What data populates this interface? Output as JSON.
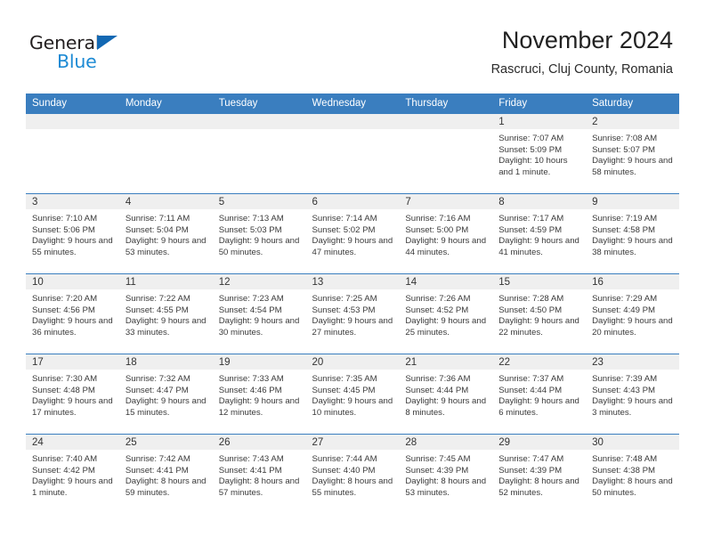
{
  "brand": {
    "word1": "General",
    "word2": "Blue",
    "triangle_color": "#1268b3",
    "blue_color": "#1c8ad4"
  },
  "header": {
    "title": "November 2024",
    "subtitle": "Rascruci, Cluj County, Romania"
  },
  "theme": {
    "header_blue": "#3a7ebf",
    "daystrip_gray": "#efefef"
  },
  "weekday_headers": [
    "Sunday",
    "Monday",
    "Tuesday",
    "Wednesday",
    "Thursday",
    "Friday",
    "Saturday"
  ],
  "weeks": [
    [
      {
        "day": "",
        "sunrise": "",
        "sunset": "",
        "daylight": "",
        "empty": true
      },
      {
        "day": "",
        "sunrise": "",
        "sunset": "",
        "daylight": "",
        "empty": true
      },
      {
        "day": "",
        "sunrise": "",
        "sunset": "",
        "daylight": "",
        "empty": true
      },
      {
        "day": "",
        "sunrise": "",
        "sunset": "",
        "daylight": "",
        "empty": true
      },
      {
        "day": "",
        "sunrise": "",
        "sunset": "",
        "daylight": "",
        "empty": true
      },
      {
        "day": "1",
        "sunrise": "Sunrise: 7:07 AM",
        "sunset": "Sunset: 5:09 PM",
        "daylight": "Daylight: 10 hours and 1 minute.",
        "empty": false
      },
      {
        "day": "2",
        "sunrise": "Sunrise: 7:08 AM",
        "sunset": "Sunset: 5:07 PM",
        "daylight": "Daylight: 9 hours and 58 minutes.",
        "empty": false
      }
    ],
    [
      {
        "day": "3",
        "sunrise": "Sunrise: 7:10 AM",
        "sunset": "Sunset: 5:06 PM",
        "daylight": "Daylight: 9 hours and 55 minutes.",
        "empty": false
      },
      {
        "day": "4",
        "sunrise": "Sunrise: 7:11 AM",
        "sunset": "Sunset: 5:04 PM",
        "daylight": "Daylight: 9 hours and 53 minutes.",
        "empty": false
      },
      {
        "day": "5",
        "sunrise": "Sunrise: 7:13 AM",
        "sunset": "Sunset: 5:03 PM",
        "daylight": "Daylight: 9 hours and 50 minutes.",
        "empty": false
      },
      {
        "day": "6",
        "sunrise": "Sunrise: 7:14 AM",
        "sunset": "Sunset: 5:02 PM",
        "daylight": "Daylight: 9 hours and 47 minutes.",
        "empty": false
      },
      {
        "day": "7",
        "sunrise": "Sunrise: 7:16 AM",
        "sunset": "Sunset: 5:00 PM",
        "daylight": "Daylight: 9 hours and 44 minutes.",
        "empty": false
      },
      {
        "day": "8",
        "sunrise": "Sunrise: 7:17 AM",
        "sunset": "Sunset: 4:59 PM",
        "daylight": "Daylight: 9 hours and 41 minutes.",
        "empty": false
      },
      {
        "day": "9",
        "sunrise": "Sunrise: 7:19 AM",
        "sunset": "Sunset: 4:58 PM",
        "daylight": "Daylight: 9 hours and 38 minutes.",
        "empty": false
      }
    ],
    [
      {
        "day": "10",
        "sunrise": "Sunrise: 7:20 AM",
        "sunset": "Sunset: 4:56 PM",
        "daylight": "Daylight: 9 hours and 36 minutes.",
        "empty": false
      },
      {
        "day": "11",
        "sunrise": "Sunrise: 7:22 AM",
        "sunset": "Sunset: 4:55 PM",
        "daylight": "Daylight: 9 hours and 33 minutes.",
        "empty": false
      },
      {
        "day": "12",
        "sunrise": "Sunrise: 7:23 AM",
        "sunset": "Sunset: 4:54 PM",
        "daylight": "Daylight: 9 hours and 30 minutes.",
        "empty": false
      },
      {
        "day": "13",
        "sunrise": "Sunrise: 7:25 AM",
        "sunset": "Sunset: 4:53 PM",
        "daylight": "Daylight: 9 hours and 27 minutes.",
        "empty": false
      },
      {
        "day": "14",
        "sunrise": "Sunrise: 7:26 AM",
        "sunset": "Sunset: 4:52 PM",
        "daylight": "Daylight: 9 hours and 25 minutes.",
        "empty": false
      },
      {
        "day": "15",
        "sunrise": "Sunrise: 7:28 AM",
        "sunset": "Sunset: 4:50 PM",
        "daylight": "Daylight: 9 hours and 22 minutes.",
        "empty": false
      },
      {
        "day": "16",
        "sunrise": "Sunrise: 7:29 AM",
        "sunset": "Sunset: 4:49 PM",
        "daylight": "Daylight: 9 hours and 20 minutes.",
        "empty": false
      }
    ],
    [
      {
        "day": "17",
        "sunrise": "Sunrise: 7:30 AM",
        "sunset": "Sunset: 4:48 PM",
        "daylight": "Daylight: 9 hours and 17 minutes.",
        "empty": false
      },
      {
        "day": "18",
        "sunrise": "Sunrise: 7:32 AM",
        "sunset": "Sunset: 4:47 PM",
        "daylight": "Daylight: 9 hours and 15 minutes.",
        "empty": false
      },
      {
        "day": "19",
        "sunrise": "Sunrise: 7:33 AM",
        "sunset": "Sunset: 4:46 PM",
        "daylight": "Daylight: 9 hours and 12 minutes.",
        "empty": false
      },
      {
        "day": "20",
        "sunrise": "Sunrise: 7:35 AM",
        "sunset": "Sunset: 4:45 PM",
        "daylight": "Daylight: 9 hours and 10 minutes.",
        "empty": false
      },
      {
        "day": "21",
        "sunrise": "Sunrise: 7:36 AM",
        "sunset": "Sunset: 4:44 PM",
        "daylight": "Daylight: 9 hours and 8 minutes.",
        "empty": false
      },
      {
        "day": "22",
        "sunrise": "Sunrise: 7:37 AM",
        "sunset": "Sunset: 4:44 PM",
        "daylight": "Daylight: 9 hours and 6 minutes.",
        "empty": false
      },
      {
        "day": "23",
        "sunrise": "Sunrise: 7:39 AM",
        "sunset": "Sunset: 4:43 PM",
        "daylight": "Daylight: 9 hours and 3 minutes.",
        "empty": false
      }
    ],
    [
      {
        "day": "24",
        "sunrise": "Sunrise: 7:40 AM",
        "sunset": "Sunset: 4:42 PM",
        "daylight": "Daylight: 9 hours and 1 minute.",
        "empty": false
      },
      {
        "day": "25",
        "sunrise": "Sunrise: 7:42 AM",
        "sunset": "Sunset: 4:41 PM",
        "daylight": "Daylight: 8 hours and 59 minutes.",
        "empty": false
      },
      {
        "day": "26",
        "sunrise": "Sunrise: 7:43 AM",
        "sunset": "Sunset: 4:41 PM",
        "daylight": "Daylight: 8 hours and 57 minutes.",
        "empty": false
      },
      {
        "day": "27",
        "sunrise": "Sunrise: 7:44 AM",
        "sunset": "Sunset: 4:40 PM",
        "daylight": "Daylight: 8 hours and 55 minutes.",
        "empty": false
      },
      {
        "day": "28",
        "sunrise": "Sunrise: 7:45 AM",
        "sunset": "Sunset: 4:39 PM",
        "daylight": "Daylight: 8 hours and 53 minutes.",
        "empty": false
      },
      {
        "day": "29",
        "sunrise": "Sunrise: 7:47 AM",
        "sunset": "Sunset: 4:39 PM",
        "daylight": "Daylight: 8 hours and 52 minutes.",
        "empty": false
      },
      {
        "day": "30",
        "sunrise": "Sunrise: 7:48 AM",
        "sunset": "Sunset: 4:38 PM",
        "daylight": "Daylight: 8 hours and 50 minutes.",
        "empty": false
      }
    ]
  ]
}
